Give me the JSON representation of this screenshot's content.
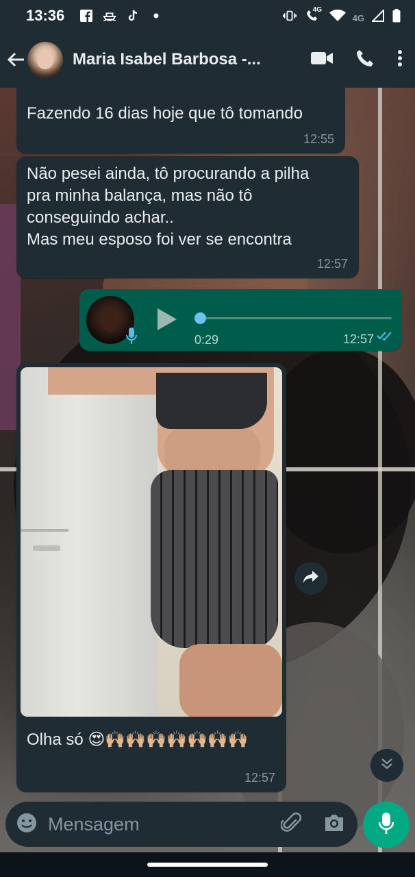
{
  "status_bar": {
    "time": "13:36",
    "left_icons": [
      "facebook-icon",
      "boat-icon",
      "tiktok-icon",
      "dot-icon"
    ],
    "network_labels": [
      "4G",
      "4G"
    ],
    "right_icons": [
      "vibrate-icon",
      "wifi-call-icon",
      "wifi-icon",
      "signal-icon",
      "battery-icon"
    ]
  },
  "header": {
    "contact_name": "Maria Isabel Barbosa -...",
    "actions": [
      "video-call-icon",
      "voice-call-icon",
      "more-options-icon"
    ]
  },
  "messages": [
    {
      "type": "incoming-text",
      "text": "Fazendo 16 dias hoje que tô tomando",
      "time": "12:55"
    },
    {
      "type": "incoming-text",
      "lines": [
        "Não pesei ainda, tô procurando a pilha",
        "pra minha balança, mas não tô",
        "conseguindo achar..",
        "Mas meu esposo foi ver se encontra"
      ],
      "time": "12:57"
    },
    {
      "type": "outgoing-voice",
      "duration": "0:29",
      "time": "12:57",
      "progress": 0
    },
    {
      "type": "incoming-image",
      "caption_text": "Olha só",
      "caption_emoji": "😍🙌🏼🙌🏼🙌🏼🙌🏼🙌🏼🙌🏼🙌🏼",
      "time": "12:57"
    }
  ],
  "composer": {
    "placeholder": "Mensagem",
    "icons": [
      "emoji-icon",
      "attach-icon",
      "camera-icon",
      "mic-icon"
    ]
  },
  "colors": {
    "header_bg": "#1f2c34",
    "incoming_bubble": "#202c33",
    "outgoing_bubble": "#005c4b",
    "accent": "#00a884",
    "read_ticks": "#53bdeb"
  }
}
